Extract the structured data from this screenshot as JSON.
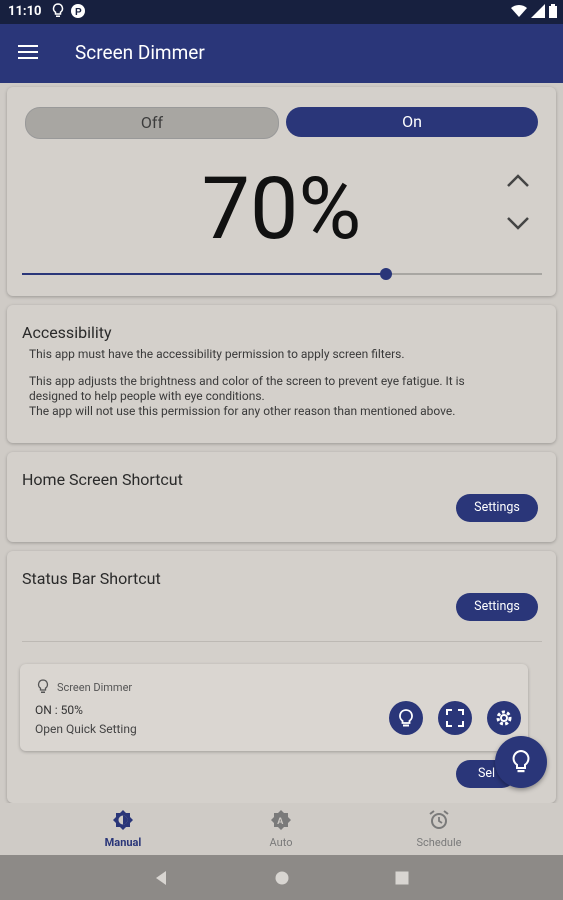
{
  "status_bar": {
    "time": "11:10"
  },
  "app_bar": {
    "title": "Screen Dimmer"
  },
  "dimmer": {
    "off_label": "Off",
    "on_label": "On",
    "percent_label": "70%",
    "slider_fraction": 0.7
  },
  "accessibility": {
    "title": "Accessibility",
    "line1": "This app must have the accessibility permission to apply screen filters.",
    "line2": "This app adjusts the brightness and color of the screen to prevent eye fatigue. It is",
    "line3": "designed to help people with eye conditions.",
    "line4": "The app will not use this permission for any other reason than mentioned above."
  },
  "home_shortcut": {
    "title": "Home Screen Shortcut",
    "button": "Settings"
  },
  "status_shortcut": {
    "title": "Status Bar Shortcut",
    "button": "Settings"
  },
  "notification": {
    "app_name": "Screen Dimmer",
    "line1": "ON : 50%",
    "line2": "Open Quick Setting",
    "partial_button": "Sel"
  },
  "bottom_nav": {
    "manual": "Manual",
    "auto": "Auto",
    "schedule": "Schedule"
  },
  "colors": {
    "accent": "#2a3679",
    "background": "#cfcbc6"
  }
}
